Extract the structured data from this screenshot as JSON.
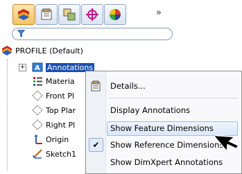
{
  "toolbar": {
    "tabs": [
      {
        "name": "featuremanager-tab-icon",
        "active": true
      },
      {
        "name": "propertymanager-tab-icon",
        "active": false
      },
      {
        "name": "configurationmanager-tab-icon",
        "active": false
      },
      {
        "name": "dimxpertmanager-tab-icon",
        "active": false
      },
      {
        "name": "display-manager-tab-icon",
        "active": false
      }
    ],
    "overflow": "»"
  },
  "tree": {
    "root": "PROFILE  (Default)",
    "items": [
      {
        "label": "Annotations",
        "icon": "annotations-icon",
        "selected": true
      },
      {
        "label": "Materia",
        "icon": "material-icon"
      },
      {
        "label": "Front Pl",
        "icon": "plane-icon"
      },
      {
        "label": "Top Plar",
        "icon": "plane-icon"
      },
      {
        "label": "Right Pl",
        "icon": "plane-icon"
      },
      {
        "label": "Origin",
        "icon": "origin-icon"
      },
      {
        "label": "Sketch1",
        "icon": "sketch-icon"
      }
    ]
  },
  "context_menu": {
    "items": [
      {
        "label": "Details...",
        "icon": "details-icon"
      },
      {
        "label": "Display Annotations"
      },
      {
        "label": "Show Feature Dimensions",
        "highlighted": true
      },
      {
        "label": "Show Reference Dimensions",
        "checked": true
      },
      {
        "label": "Show DimXpert Annotations"
      }
    ]
  },
  "colors": {
    "selection": "#1a4fb4",
    "menu_background": "#f9f9fb",
    "highlight": "#dbe8fa"
  }
}
